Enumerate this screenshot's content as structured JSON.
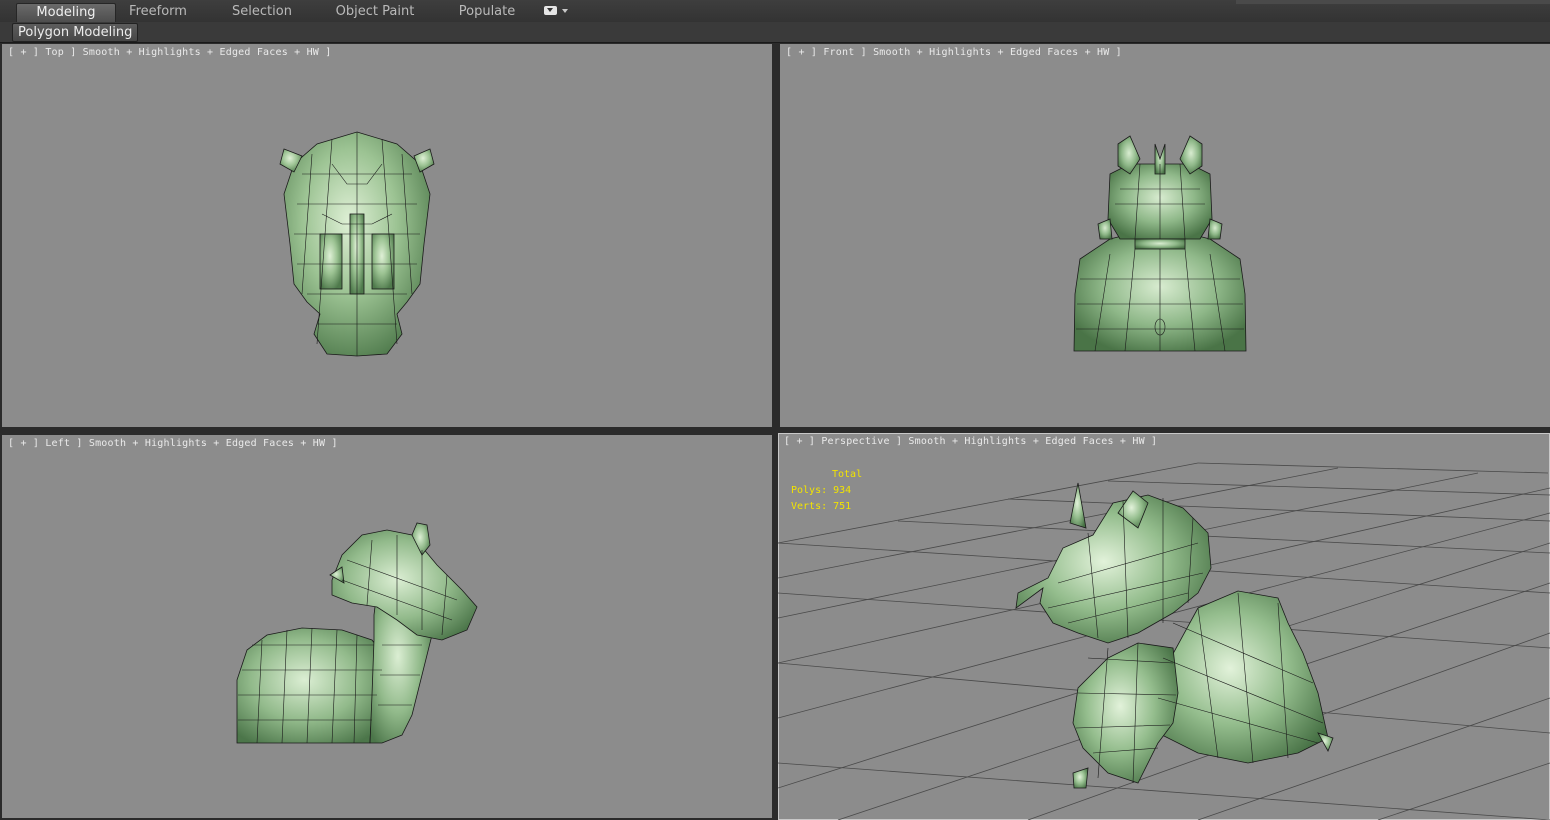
{
  "ribbon": {
    "tabs": [
      {
        "label": "Modeling",
        "active": true
      },
      {
        "label": "Freeform",
        "active": false
      },
      {
        "label": "Selection",
        "active": false
      },
      {
        "label": "Object Paint",
        "active": false
      },
      {
        "label": "Populate",
        "active": false
      }
    ],
    "toggle_icon": "ribbon-minimize-icon"
  },
  "panel": {
    "title": "Polygon Modeling"
  },
  "viewports": {
    "top": {
      "label": "[ + ] Top ] Smooth + Highlights + Edged Faces + HW ]"
    },
    "front": {
      "label": "[ + ] Front ] Smooth + Highlights + Edged Faces + HW ]"
    },
    "left": {
      "label": "[ + ] Left ] Smooth + Highlights + Edged Faces + HW ]"
    },
    "perspective": {
      "label": "[ + ] Perspective ] Smooth + Highlights + Edged Faces + HW ]"
    }
  },
  "stats": {
    "total_label": "Total",
    "polys_label": "Polys:",
    "polys_value": "934",
    "verts_label": "Verts:",
    "verts_value": "751"
  },
  "colors": {
    "viewport_bg": "#8c8c8c",
    "model_green": "#8fb889",
    "stats_yellow": "#f2e400"
  }
}
